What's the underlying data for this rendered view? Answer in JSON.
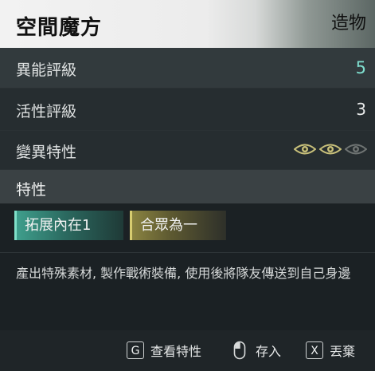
{
  "header": {
    "title": "空間魔方",
    "type_label": "造物"
  },
  "stats": [
    {
      "label": "異能評級",
      "value": "5"
    },
    {
      "label": "活性評級",
      "value": "3"
    },
    {
      "label": "變異特性",
      "eyes_active": 2,
      "eyes_total": 3
    }
  ],
  "traits_section": {
    "label": "特性"
  },
  "traits": [
    {
      "label": "拓展內在1",
      "color": "#3f9e8c"
    },
    {
      "label": "合眾為一",
      "color": "#8a8341"
    }
  ],
  "description": "產出特殊素材, 製作戰術裝備, 使用後將隊友傳送到自己身邊",
  "footer": {
    "view_key": "G",
    "view_label": "查看特性",
    "store_label": "存入",
    "drop_key": "X",
    "drop_label": "丟棄"
  },
  "colors": {
    "accent_teal": "#7fe0d0",
    "eye_gold": "#c8c07a",
    "eye_dim": "#6f7473"
  }
}
